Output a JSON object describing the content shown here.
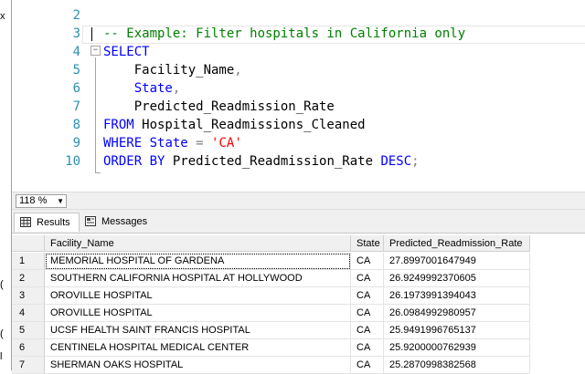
{
  "left_fragments": [
    "x",
    "(",
    "(",
    "l"
  ],
  "editor": {
    "line_numbers": [
      "2",
      "3",
      "4",
      "5",
      "6",
      "7",
      "8",
      "9",
      "10"
    ],
    "lines": [
      {
        "num": "2",
        "parts": []
      },
      {
        "num": "3",
        "parts": [
          {
            "t": "-- Example: Filter hospitals in California only",
            "c": "cm"
          }
        ]
      },
      {
        "num": "4",
        "parts": [
          {
            "t": "SELECT",
            "c": "kw"
          }
        ]
      },
      {
        "num": "5",
        "parts": [
          {
            "t": "    Facility_Name",
            "c": ""
          },
          {
            "t": ",",
            "c": "op"
          }
        ]
      },
      {
        "num": "6",
        "parts": [
          {
            "t": "    State",
            "c": "kw"
          },
          {
            "t": ",",
            "c": "op"
          }
        ]
      },
      {
        "num": "7",
        "parts": [
          {
            "t": "    Predicted_Readmission_Rate",
            "c": ""
          }
        ]
      },
      {
        "num": "8",
        "parts": [
          {
            "t": "FROM",
            "c": "kw"
          },
          {
            "t": " Hospital_Readmissions_Cleaned",
            "c": ""
          }
        ]
      },
      {
        "num": "9",
        "parts": [
          {
            "t": "WHERE",
            "c": "kw"
          },
          {
            "t": " State",
            "c": "kw"
          },
          {
            "t": " = ",
            "c": "op"
          },
          {
            "t": "'CA'",
            "c": "st"
          }
        ]
      },
      {
        "num": "10",
        "parts": [
          {
            "t": "ORDER BY",
            "c": "kw"
          },
          {
            "t": " Predicted_Readmission_Rate ",
            "c": ""
          },
          {
            "t": "DESC",
            "c": "kw"
          },
          {
            "t": ";",
            "c": "op"
          }
        ]
      }
    ]
  },
  "zoom": {
    "value": "118 %",
    "arrow_icon": "dropdown-arrow-icon"
  },
  "tabs": [
    {
      "label": "Results",
      "icon": "grid-icon",
      "active": true
    },
    {
      "label": "Messages",
      "icon": "messages-icon",
      "active": false
    }
  ],
  "grid": {
    "columns": [
      "Facility_Name",
      "State",
      "Predicted_Readmission_Rate"
    ],
    "rows": [
      {
        "n": "1",
        "cells": [
          "MEMORIAL HOSPITAL OF GARDENA",
          "CA",
          "27.8997001647949"
        ]
      },
      {
        "n": "2",
        "cells": [
          "SOUTHERN CALIFORNIA HOSPITAL AT HOLLYWOOD",
          "CA",
          "26.9249992370605"
        ]
      },
      {
        "n": "3",
        "cells": [
          "OROVILLE HOSPITAL",
          "CA",
          "26.1973991394043"
        ]
      },
      {
        "n": "4",
        "cells": [
          "OROVILLE HOSPITAL",
          "CA",
          "26.0984992980957"
        ]
      },
      {
        "n": "5",
        "cells": [
          "UCSF HEALTH SAINT FRANCIS HOSPITAL",
          "CA",
          "25.9491996765137"
        ]
      },
      {
        "n": "6",
        "cells": [
          "CENTINELA HOSPITAL MEDICAL CENTER",
          "CA",
          "25.9200000762939"
        ]
      },
      {
        "n": "7",
        "cells": [
          "SHERMAN OAKS HOSPITAL",
          "CA",
          "25.2870998382568"
        ]
      }
    ]
  }
}
